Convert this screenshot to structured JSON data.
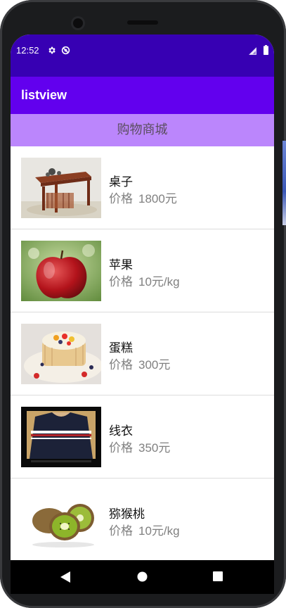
{
  "status_bar": {
    "time": "12:52"
  },
  "app_bar": {
    "title": "listview"
  },
  "header": {
    "title": "购物商城"
  },
  "items": [
    {
      "name": "桌子",
      "price_label": "价格",
      "price": "1800元",
      "image": "tea-table"
    },
    {
      "name": "苹果",
      "price_label": "价格",
      "price": "10元/kg",
      "image": "red-apple"
    },
    {
      "name": "蛋糕",
      "price_label": "价格",
      "price": "300元",
      "image": "fruit-cake"
    },
    {
      "name": "线衣",
      "price_label": "价格",
      "price": "350元",
      "image": "striped-sweater"
    },
    {
      "name": "猕猴桃",
      "price_label": "价格",
      "price": "10元/kg",
      "image": "kiwi"
    }
  ],
  "nav_bar": {
    "buttons": [
      "back",
      "home",
      "recents"
    ]
  },
  "colors": {
    "status_bar": "#3700b3",
    "app_bar": "#6200ee",
    "header": "#bb86fc"
  }
}
